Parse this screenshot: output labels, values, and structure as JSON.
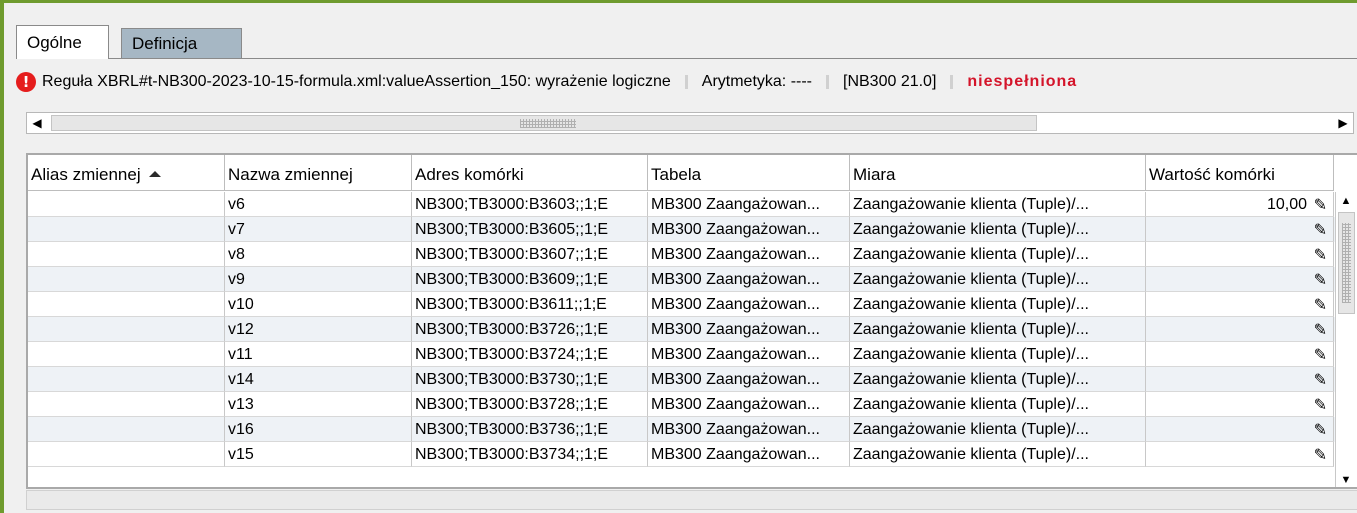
{
  "tabs": [
    {
      "label": "Ogólne",
      "active": true
    },
    {
      "label": "Definicja",
      "active": false
    }
  ],
  "info": {
    "icon": "error-icon",
    "rule": "Reguła XBRL#t-NB300-2023-10-15-formula.xml:valueAssertion_150: wyrażenie logiczne",
    "arithmetic": "Arytmetyka: ----",
    "code": "[NB300 21.0]",
    "status": "niespełniona",
    "status_color": "#d4142a"
  },
  "table": {
    "columns": [
      "Alias zmiennej",
      "Nazwa zmiennej",
      "Adres komórki",
      "Tabela",
      "Miara",
      "Wartość komórki"
    ],
    "sort_column": "Alias zmiennej",
    "rows": [
      {
        "alias": "",
        "name": "v6",
        "address": "NB300;TB3000:B3603;;1;E",
        "table": "MB300 Zaangażowan...",
        "measure": "Zaangażowanie klienta (Tuple)/...",
        "value": "10,00"
      },
      {
        "alias": "",
        "name": "v7",
        "address": "NB300;TB3000:B3605;;1;E",
        "table": "MB300 Zaangażowan...",
        "measure": "Zaangażowanie klienta (Tuple)/...",
        "value": ""
      },
      {
        "alias": "",
        "name": "v8",
        "address": "NB300;TB3000:B3607;;1;E",
        "table": "MB300 Zaangażowan...",
        "measure": "Zaangażowanie klienta (Tuple)/...",
        "value": ""
      },
      {
        "alias": "",
        "name": "v9",
        "address": "NB300;TB3000:B3609;;1;E",
        "table": "MB300 Zaangażowan...",
        "measure": "Zaangażowanie klienta (Tuple)/...",
        "value": ""
      },
      {
        "alias": "",
        "name": "v10",
        "address": "NB300;TB3000:B3611;;1;E",
        "table": "MB300 Zaangażowan...",
        "measure": "Zaangażowanie klienta (Tuple)/...",
        "value": ""
      },
      {
        "alias": "",
        "name": "v12",
        "address": "NB300;TB3000:B3726;;1;E",
        "table": "MB300 Zaangażowan...",
        "measure": "Zaangażowanie klienta (Tuple)/...",
        "value": ""
      },
      {
        "alias": "",
        "name": "v11",
        "address": "NB300;TB3000:B3724;;1;E",
        "table": "MB300 Zaangażowan...",
        "measure": "Zaangażowanie klienta (Tuple)/...",
        "value": ""
      },
      {
        "alias": "",
        "name": "v14",
        "address": "NB300;TB3000:B3730;;1;E",
        "table": "MB300 Zaangażowan...",
        "measure": "Zaangażowanie klienta (Tuple)/...",
        "value": ""
      },
      {
        "alias": "",
        "name": "v13",
        "address": "NB300;TB3000:B3728;;1;E",
        "table": "MB300 Zaangażowan...",
        "measure": "Zaangażowanie klienta (Tuple)/...",
        "value": ""
      },
      {
        "alias": "",
        "name": "v16",
        "address": "NB300;TB3000:B3736;;1;E",
        "table": "MB300 Zaangażowan...",
        "measure": "Zaangażowanie klienta (Tuple)/...",
        "value": ""
      },
      {
        "alias": "",
        "name": "v15",
        "address": "NB300;TB3000:B3734;;1;E",
        "table": "MB300 Zaangażowan...",
        "measure": "Zaangażowanie klienta (Tuple)/...",
        "value": ""
      }
    ],
    "edit_icon": "pencil-icon"
  }
}
